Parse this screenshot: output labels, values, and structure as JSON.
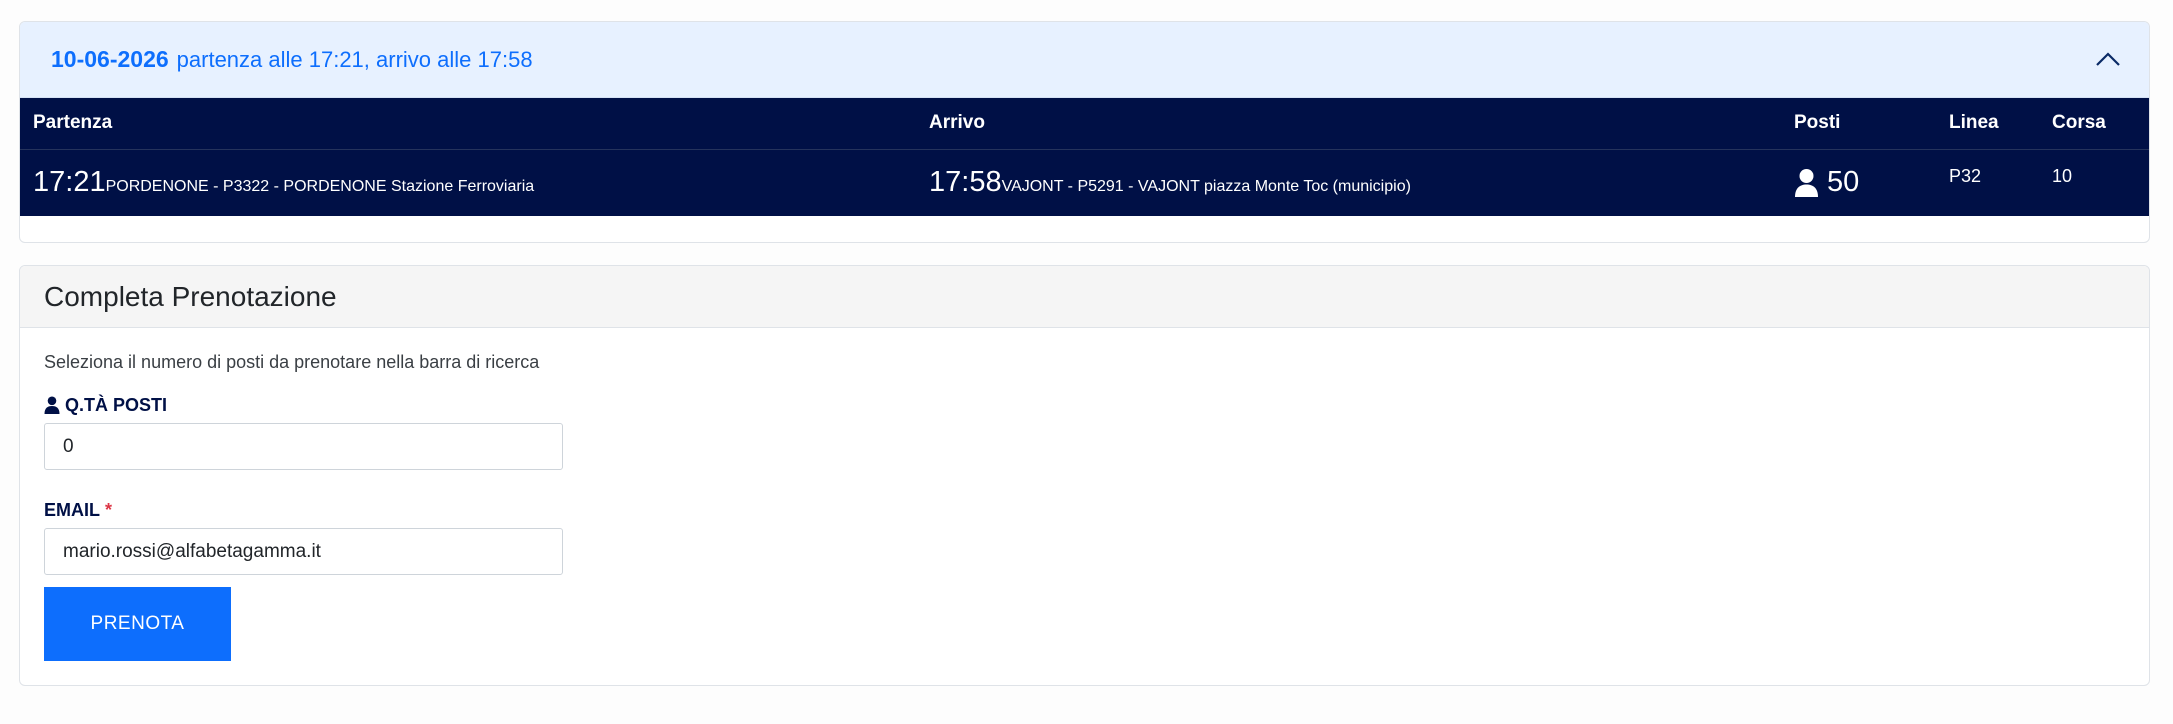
{
  "trip": {
    "date": "10-06-2026",
    "summary": "partenza alle 17:21, arrivo alle 17:58",
    "columns": {
      "departure": "Partenza",
      "arrival": "Arrivo",
      "seats": "Posti",
      "line": "Linea",
      "run": "Corsa"
    },
    "row": {
      "dep_time": "17:21",
      "dep_stop": "PORDENONE - P3322 - PORDENONE Stazione Ferroviaria",
      "arr_time": "17:58",
      "arr_stop": "VAJONT - P5291 - VAJONT piazza Monte Toc (municipio)",
      "seats": "50",
      "line": "P32",
      "run": "10"
    },
    "colors": {
      "header_bg": "#e7f1ff",
      "accent": "#0d6efd",
      "table_bg": "#001046"
    },
    "icons": {
      "collapse": "chevron-up-icon",
      "seats": "user-icon"
    }
  },
  "booking": {
    "title": "Completa Prenotazione",
    "hint": "Seleziona il numero di posti da prenotare nella barra di ricerca",
    "qty_label": "Q.TÀ POSTI",
    "qty_value": "0",
    "email_label": "EMAIL",
    "email_required": "*",
    "email_value": "mario.rossi@alfabetagamma.it",
    "submit_label": "PRENOTA",
    "colors": {
      "button": "#0d6efd",
      "required": "#dc3545"
    }
  }
}
